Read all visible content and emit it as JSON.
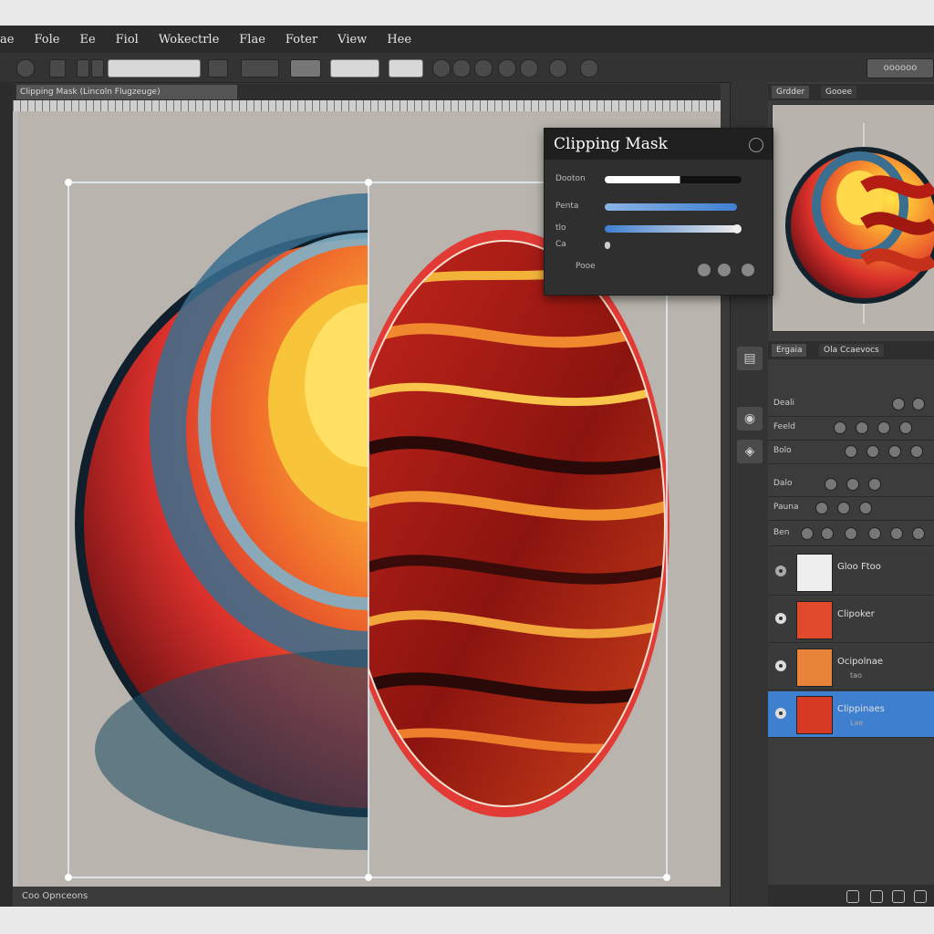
{
  "menubar": {
    "items": [
      "ae",
      "Fole",
      "Ee",
      "Fiol",
      "Wokectrle",
      "Flae",
      "Foter",
      "View",
      "Hee"
    ]
  },
  "toolbar": {
    "right_button_label": "oooooo"
  },
  "document": {
    "tab_label": "Clipping Mask (Lincoln Flugzeuge)"
  },
  "status": {
    "text": "Coo Opnceons"
  },
  "dialog": {
    "title": "Clipping Mask",
    "rows": [
      "Dooton",
      "Penta",
      "tlo",
      "Ca"
    ],
    "footer_label": "Pooe"
  },
  "panel": {
    "tabs": [
      "Grdder",
      "Gooee"
    ],
    "layers_tabs": [
      "Ergaia",
      "Ola Ccaevocs"
    ],
    "prop_rows": [
      "Deali",
      "Feeld",
      "Bolo",
      "Dalo",
      "Pauna",
      "Ben"
    ],
    "layers": [
      {
        "name": "Gloo Ftoo",
        "sub": ""
      },
      {
        "name": "Clipoker",
        "sub": ""
      },
      {
        "name": "Ocipolnae",
        "sub": "tao"
      },
      {
        "name": "Clippinaes",
        "sub": "Lae"
      }
    ]
  },
  "colors": {
    "accent": "#3f7fd0",
    "ui_dark": "#2b2b2b",
    "canvas": "#b9b4ad"
  }
}
